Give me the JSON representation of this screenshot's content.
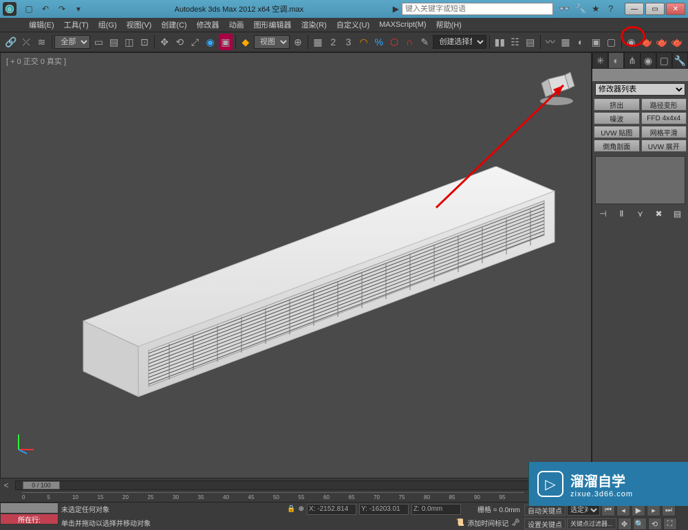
{
  "title": "Autodesk 3ds Max  2012 x64   空调.max",
  "search_placeholder": "键入关键字或短语",
  "menus": [
    "编辑(E)",
    "工具(T)",
    "组(G)",
    "视图(V)",
    "创建(C)",
    "修改器",
    "动画",
    "图形编辑器",
    "渲染(R)",
    "自定义(U)",
    "MAXScript(M)",
    "帮助(H)"
  ],
  "toolbar": {
    "filter": "全部",
    "view": "视图",
    "selset": "创建选择集"
  },
  "viewport": {
    "label": "[ + 0 正交 0 真实 ]"
  },
  "cmd_panel": {
    "modifier_list": "修改器列表",
    "mods": [
      "挤出",
      "路径变形",
      "噪波",
      "FFD 4x4x4",
      "UVW 贴图",
      "网格平滑",
      "倒角剖面",
      "UVW 展开"
    ]
  },
  "timeline": {
    "handle": "0 / 100"
  },
  "ruler_ticks": [
    "0",
    "5",
    "10",
    "15",
    "20",
    "25",
    "30",
    "35",
    "40",
    "45",
    "50",
    "55",
    "60",
    "65",
    "70",
    "75",
    "80",
    "85",
    "90",
    "95"
  ],
  "status": {
    "tab2": "所在行:",
    "line1": "未选定任何对象",
    "line2": "单击并拖动以选择并移动对象",
    "x": "X: -2152.814",
    "y": "Y: -16203.01",
    "z": "Z: 0.0mm",
    "grid": "栅格 = 0.0mm",
    "add_time": "添加时间标记",
    "auto_key": "自动关键点",
    "set_key": "设置关键点",
    "sel_obj": "选定对象",
    "key_filter": "关键点过滤器..."
  },
  "watermark": {
    "main": "溜溜自学",
    "sub": "zixue.3d66.com"
  }
}
